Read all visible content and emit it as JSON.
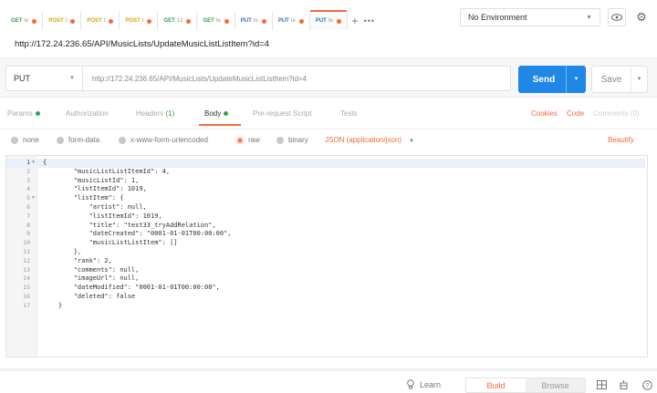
{
  "tabs": [
    {
      "method": "GET",
      "label": "te",
      "method_class": "m-get"
    },
    {
      "method": "POST",
      "label": "t",
      "method_class": "m-post"
    },
    {
      "method": "POST",
      "label": "t",
      "method_class": "m-post"
    },
    {
      "method": "POST",
      "label": "t",
      "method_class": "m-post"
    },
    {
      "method": "GET",
      "label": "12",
      "method_class": "m-get"
    },
    {
      "method": "GET",
      "label": "te",
      "method_class": "m-get"
    },
    {
      "method": "PUT",
      "label": "te",
      "method_class": "m-put"
    },
    {
      "method": "PUT",
      "label": "te",
      "method_class": "m-put"
    },
    {
      "method": "PUT",
      "label": "te",
      "method_class": "m-put",
      "active": true
    }
  ],
  "tab_add": "+",
  "tab_more": "•••",
  "environment": {
    "selected": "No Environment"
  },
  "request": {
    "title": "http://172.24.236.65/API/MusicLists/UpdateMusicListListItem?id=4",
    "method": "PUT",
    "url": "http://172.24.236.65/API/MusicLists/UpdateMusicListListItem?id=4",
    "send_label": "Send",
    "save_label": "Save"
  },
  "subtabs": {
    "params": "Params",
    "authorization": "Authorization",
    "headers": "Headers",
    "headers_count": "(1)",
    "body": "Body",
    "prerequest": "Pre-request Script",
    "tests": "Tests",
    "cookies": "Cookies",
    "code": "Code",
    "comments": "Comments (0)"
  },
  "body_types": {
    "none": "none",
    "form_data": "form-data",
    "urlencoded": "x-www-form-urlencoded",
    "raw": "raw",
    "binary": "binary",
    "format": "JSON (application/json)",
    "beautify": "Beautify"
  },
  "editor_lines": [
    "{",
    "        \"musicListListItemId\": 4,",
    "        \"musicListId\": 1,",
    "        \"listItemId\": 1019,",
    "        \"listItem\": {",
    "            \"artist\": null,",
    "            \"listItemId\": 1019,",
    "            \"title\": \"test33_tryAddRelation\",",
    "            \"dateCreated\": \"0001-01-01T00:00:00\",",
    "            \"musicListListItem\": []",
    "        },",
    "        \"rank\": 2,",
    "        \"comments\": null,",
    "        \"imageUrl\": null,",
    "        \"dateModified\": \"0001-01-01T00:00:00\",",
    "        \"deleted\": false",
    "    }"
  ],
  "editor_line_numbers": [
    "1",
    "2",
    "3",
    "4",
    "5",
    "6",
    "7",
    "8",
    "9",
    "10",
    "11",
    "12",
    "13",
    "14",
    "15",
    "16",
    "17"
  ],
  "footer": {
    "learn": "Learn",
    "build": "Build",
    "browse": "Browse"
  },
  "colors": {
    "accent": "#f26b3a",
    "send": "#1f87e5",
    "get": "#2ea44f",
    "post": "#d9a400",
    "put": "#3b6ea8"
  }
}
